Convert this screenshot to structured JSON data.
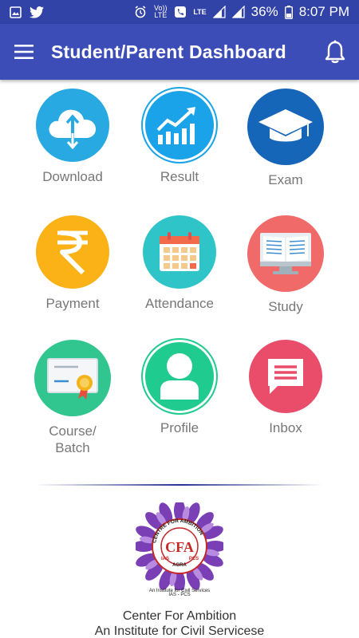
{
  "status_bar": {
    "volte": "Vo)) LTE",
    "lte": "LTE",
    "battery": "36%",
    "time": "8:07 PM"
  },
  "app_bar": {
    "title": "Student/Parent Dashboard"
  },
  "tiles": [
    {
      "label": "Download",
      "icon": "cloud-download-icon",
      "color": "#29a9e1"
    },
    {
      "label": "Result",
      "icon": "chart-up-icon",
      "color": "#1aa3e8"
    },
    {
      "label": "Exam",
      "icon": "graduation-cap-icon",
      "color": "#1565b8"
    },
    {
      "label": "Payment",
      "icon": "rupee-icon",
      "color": "#fbb217"
    },
    {
      "label": "Attendance",
      "icon": "calendar-icon",
      "color": "#2ec4c8"
    },
    {
      "label": "Study",
      "icon": "open-book-monitor-icon",
      "color": "#f16a6a"
    },
    {
      "label": "Course/\nBatch",
      "icon": "certificate-icon",
      "color": "#31c68f"
    },
    {
      "label": "Profile",
      "icon": "user-icon",
      "color": "#1fcb8f"
    },
    {
      "label": "Inbox",
      "icon": "message-icon",
      "color": "#e94d6a"
    }
  ],
  "logo": {
    "ring_text": "CENTRE FOR AMBITION",
    "monogram": "CFA",
    "side_left": "IAS",
    "side_right": "PCS",
    "bottom": "AGRA",
    "caption_1": "An Institute for Civil Services",
    "caption_2": "IAS - PCS"
  },
  "footer": {
    "line1": "Center For Ambition",
    "line2": "An Institute for Civil Servicese"
  }
}
